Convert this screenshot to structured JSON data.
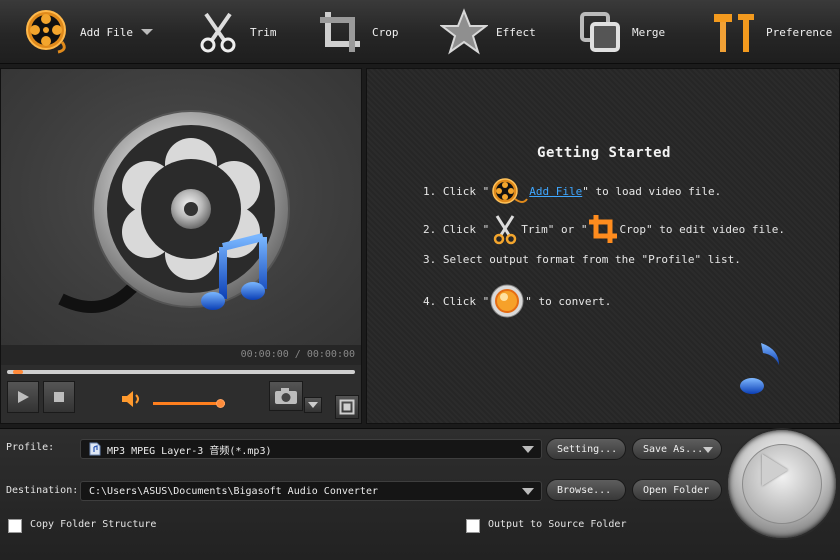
{
  "toolbar": {
    "add_file": "Add File",
    "trim": "Trim",
    "crop": "Crop",
    "effect": "Effect",
    "merge": "Merge",
    "preference": "Preference"
  },
  "preview": {
    "time": "00:00:00 / 00:00:00",
    "seek_progress": 0.0,
    "volume_level": 0.9
  },
  "guide": {
    "title": "Getting Started",
    "step1": {
      "num": "1. Click \"",
      "link": "Add File",
      "rest": "\" to load video file."
    },
    "step2": {
      "num": "2. Click \"",
      "trim": " Trim\" or \"",
      "rest": " Crop\" to edit video file."
    },
    "step3": {
      "text": "3. Select output format from the \"Profile\" list."
    },
    "step4": {
      "num": "4. Click \"",
      "rest": "\" to convert."
    }
  },
  "bottom": {
    "profile_label": "Profile:",
    "profile_value": "MP3 MPEG Layer-3 音频(*.mp3)",
    "setting_button": "Setting...",
    "save_as_button": "Save As...",
    "destination_label": "Destination:",
    "destination_value": "C:\\Users\\ASUS\\Documents\\Bigasoft Audio Converter",
    "browse_button": "Browse...",
    "open_folder_button": "Open Folder",
    "copy_folder_label": "Copy Folder Structure",
    "output_source_label": "Output to Source Folder"
  },
  "colors": {
    "accent_orange": "#ff8c1e",
    "link_blue": "#3fa7ff",
    "note_blue": "#1f5fd8"
  },
  "icons": {
    "add_file": "film-reel-icon",
    "trim": "scissors-icon",
    "crop": "crop-icon",
    "effect": "star-icon",
    "merge": "merge-icon",
    "preference": "tools-icon"
  }
}
